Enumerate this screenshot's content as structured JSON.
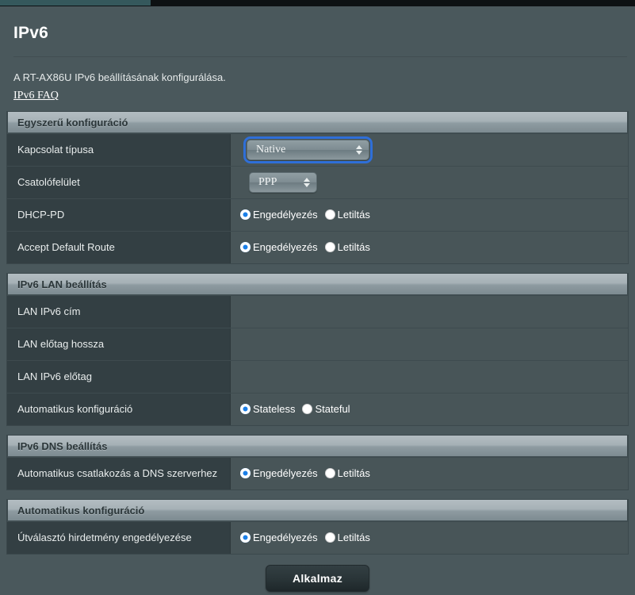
{
  "header": {
    "title": "IPv6",
    "description": "A RT-AX86U IPv6 beállításának konfigurálása.",
    "faq_link": "IPv6 FAQ"
  },
  "radio_labels": {
    "enable": "Engedélyezés",
    "disable": "Letiltás",
    "stateless": "Stateless",
    "stateful": "Stateful"
  },
  "sections": [
    {
      "title": "Egyszerű konfiguráció",
      "rows": [
        {
          "label": "Kapcsolat típusa",
          "type": "select",
          "value": "Native",
          "focused": true
        },
        {
          "label": "Csatolófelület",
          "type": "select",
          "value": "PPP",
          "focused": false
        },
        {
          "label": "DHCP-PD",
          "type": "radio",
          "selected": "enable"
        },
        {
          "label": "Accept Default Route",
          "type": "radio",
          "selected": "enable"
        }
      ]
    },
    {
      "title": "IPv6 LAN beállítás",
      "rows": [
        {
          "label": "LAN IPv6 cím",
          "type": "empty",
          "value": ""
        },
        {
          "label": "LAN előtag hossza",
          "type": "empty",
          "value": ""
        },
        {
          "label": "LAN IPv6 előtag",
          "type": "empty",
          "value": ""
        },
        {
          "label": "Automatikus konfiguráció",
          "type": "radio-state",
          "selected": "stateless"
        }
      ]
    },
    {
      "title": "IPv6 DNS beállítás",
      "rows": [
        {
          "label": "Automatikus csatlakozás a DNS szerverhez",
          "type": "radio",
          "selected": "enable"
        }
      ]
    },
    {
      "title": "Automatikus konfiguráció",
      "rows": [
        {
          "label": "Útválasztó hirdetmény engedélyezése",
          "type": "radio",
          "selected": "enable"
        }
      ]
    }
  ],
  "footer": {
    "apply_label": "Alkalmaz"
  },
  "colors": {
    "page_background": "#4a585c",
    "label_cell": "#333f43",
    "value_cell": "#485558",
    "radio_accent": "#1a7fe8",
    "section_header_text": "#2b3639"
  }
}
